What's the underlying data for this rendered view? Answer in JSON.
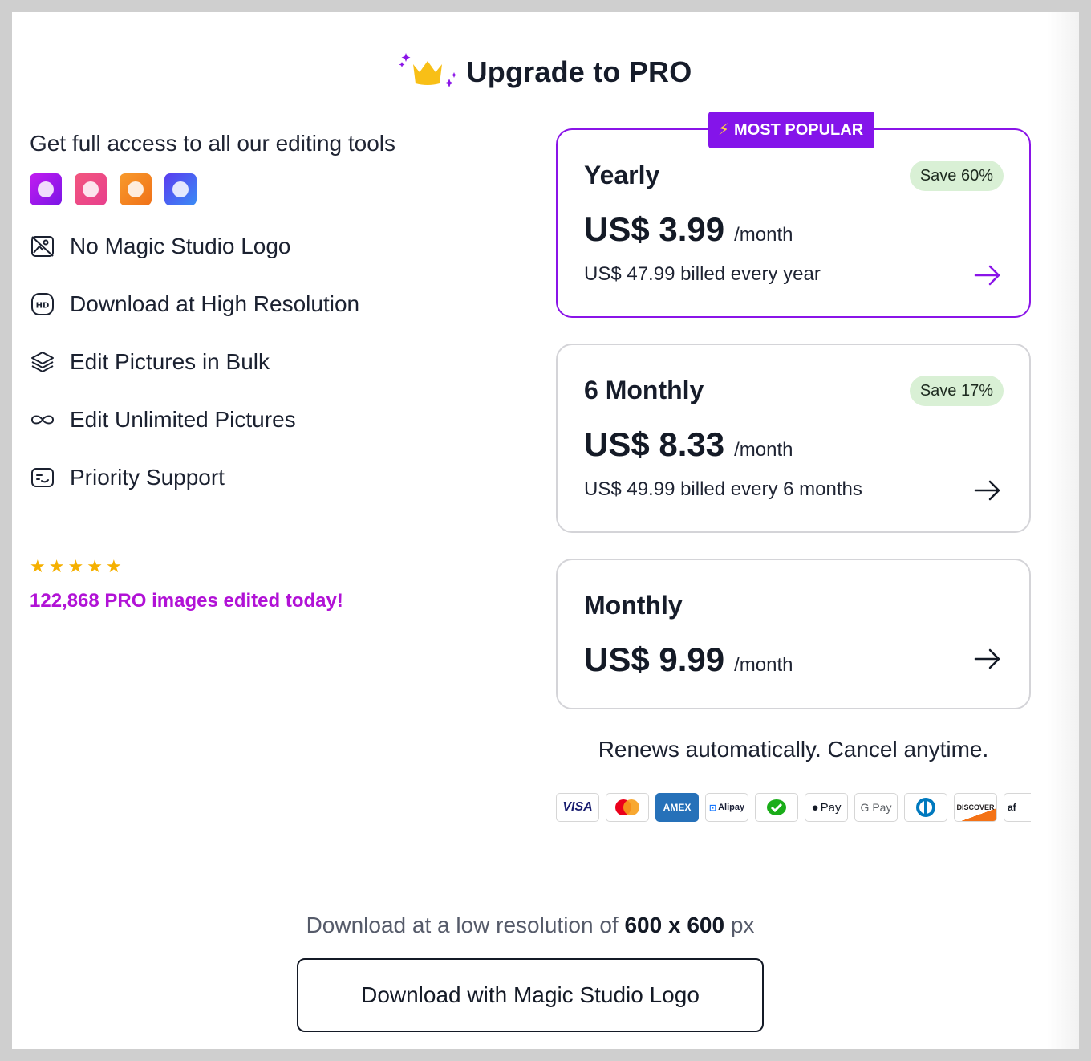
{
  "header": {
    "title": "Upgrade to PRO"
  },
  "left": {
    "intro": "Get full access to all our editing tools",
    "tools": [
      {
        "icon": "tool-purple-icon",
        "color": "#a020f0"
      },
      {
        "icon": "tool-pink-icon",
        "color": "#f0467a"
      },
      {
        "icon": "tool-orange-icon",
        "color": "#f5862a"
      },
      {
        "icon": "tool-blue-icon",
        "color": "#4a5cf5"
      }
    ],
    "features": [
      {
        "icon": "no-logo-icon",
        "label": "No Magic Studio Logo"
      },
      {
        "icon": "hd-icon",
        "label": "Download at High Resolution"
      },
      {
        "icon": "layers-icon",
        "label": "Edit Pictures in Bulk"
      },
      {
        "icon": "infinity-icon",
        "label": "Edit Unlimited Pictures"
      },
      {
        "icon": "support-icon",
        "label": "Priority Support"
      }
    ],
    "rating_stars": 5,
    "edited_today": "122,868 PRO images edited today!"
  },
  "plans": [
    {
      "name": "Yearly",
      "badge": "MOST POPULAR",
      "save": "Save 60%",
      "price": "US$ 3.99",
      "per": "/month",
      "billed": "US$ 47.99 billed every year"
    },
    {
      "name": "6 Monthly",
      "save": "Save 17%",
      "price": "US$ 8.33",
      "per": "/month",
      "billed": "US$ 49.99 billed every 6 months"
    },
    {
      "name": "Monthly",
      "price": "US$ 9.99",
      "per": "/month"
    }
  ],
  "renews": "Renews automatically. Cancel anytime.",
  "payment_methods": [
    {
      "name": "visa-icon",
      "label": "VISA"
    },
    {
      "name": "mastercard-icon",
      "label": ""
    },
    {
      "name": "amex-icon",
      "label": "AMEX"
    },
    {
      "name": "alipay-icon",
      "label": "Alipay"
    },
    {
      "name": "wechat-pay-icon",
      "label": ""
    },
    {
      "name": "apple-pay-icon",
      "label": "Pay"
    },
    {
      "name": "google-pay-icon",
      "label": "G Pay"
    },
    {
      "name": "diners-club-icon",
      "label": ""
    },
    {
      "name": "discover-icon",
      "label": "DISCOVER"
    },
    {
      "name": "afterpay-icon",
      "label": "af"
    }
  ],
  "footer": {
    "lowres_prefix": "Download at a low resolution of",
    "lowres_size": "600 x 600",
    "lowres_unit": "px",
    "download_label": "Download with Magic Studio Logo"
  },
  "colors": {
    "accent": "#8414ea",
    "edited_text": "#b112d6",
    "save_pill": "#d9f0d5",
    "star": "#f5b000"
  }
}
